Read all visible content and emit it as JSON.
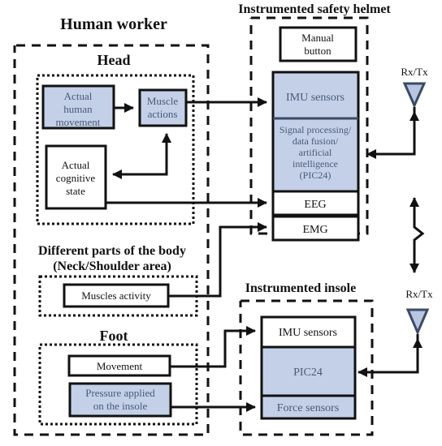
{
  "titles": {
    "human_worker": "Human worker",
    "head": "Head",
    "body_parts_line1": "Different parts of the body",
    "body_parts_line2": "(Neck/Shoulder area)",
    "foot": "Foot",
    "helmet": "Instrumented safety helmet",
    "insole": "Instrumented insole"
  },
  "head_blocks": {
    "movement": [
      "Actual",
      "human",
      "movement"
    ],
    "muscle": [
      "Muscle",
      "actions"
    ],
    "cognitive": [
      "Actual",
      "cognitive",
      "state"
    ]
  },
  "body_blocks": {
    "muscles_activity": "Muscles activity"
  },
  "foot_blocks": {
    "movement": "Movement",
    "pressure": [
      "Pressure applied",
      "on the insole"
    ]
  },
  "helmet_blocks": {
    "manual": [
      "Manual",
      "button"
    ],
    "imu": "IMU sensors",
    "signal": [
      "Signal processing/",
      "data fusion/",
      "artificial",
      "intelligence",
      "(PIC24)"
    ],
    "eeg": "EEG",
    "emg": "EMG"
  },
  "insole_blocks": {
    "imu": "IMU sensors",
    "pic": "PIC24",
    "force": "Force sensors"
  },
  "antennas": {
    "helmet": "Rx/Tx",
    "insole": "Rx/Tx"
  },
  "colors": {
    "block_fill": "#c3d0e8",
    "block_text": "#4a5a78",
    "line": "#111111"
  }
}
